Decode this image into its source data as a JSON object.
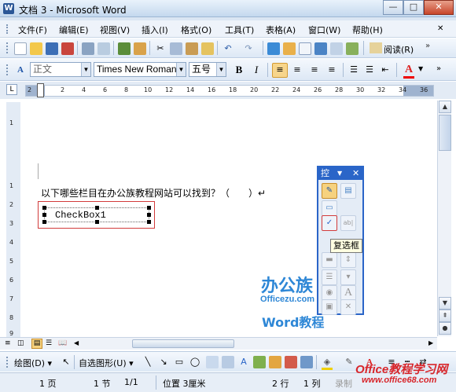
{
  "window": {
    "title": "文档 3 - Microsoft Word",
    "app_icon": "W",
    "min": "—",
    "max": "□",
    "close": "✕"
  },
  "menu": [
    "文件(F)",
    "编辑(E)",
    "视图(V)",
    "插入(I)",
    "格式(O)",
    "工具(T)",
    "表格(A)",
    "窗口(W)",
    "帮助(H)"
  ],
  "toolbar": {
    "read_label": "阅读(R)",
    "font_label_A": "A"
  },
  "format": {
    "style": "正文",
    "font": "Times New Roman",
    "size": "五号",
    "bold": "B",
    "italic": "I",
    "color_a": "A"
  },
  "ruler": {
    "h_ticks": [
      "2",
      "2",
      "4",
      "6",
      "8",
      "10",
      "12",
      "14",
      "16",
      "18",
      "20",
      "22",
      "24",
      "26",
      "28",
      "30",
      "32",
      "34",
      "36"
    ],
    "v_ticks": [
      "1",
      "1",
      "2",
      "3",
      "4",
      "5",
      "6",
      "7",
      "8",
      "9"
    ],
    "corner": "L"
  },
  "document": {
    "question": "以下哪些栏目在办公族教程网站可以找到？（　　）↵",
    "checkbox_label": "CheckBox1"
  },
  "control_palette": {
    "title": "控",
    "tooltip": "复选框",
    "checkbox_glyph": "✓",
    "text_glyph": "ab|",
    "letter_a": "A"
  },
  "drawing": {
    "draw_label": "绘图(D) ▾",
    "autoshape_label": "自选图形(U) ▾",
    "font_color_a": "A"
  },
  "status": {
    "page": "1 页",
    "section": "1 节",
    "pages": "1/1",
    "position": "位置 3厘米",
    "row": "2 行",
    "col": "1 列",
    "record": "录制"
  },
  "watermark": {
    "line1": "办公族",
    "line2": "Officezu.com",
    "line3": "Word教程",
    "site_big": "Office教程学习网",
    "site_small": "www.office68.com"
  }
}
